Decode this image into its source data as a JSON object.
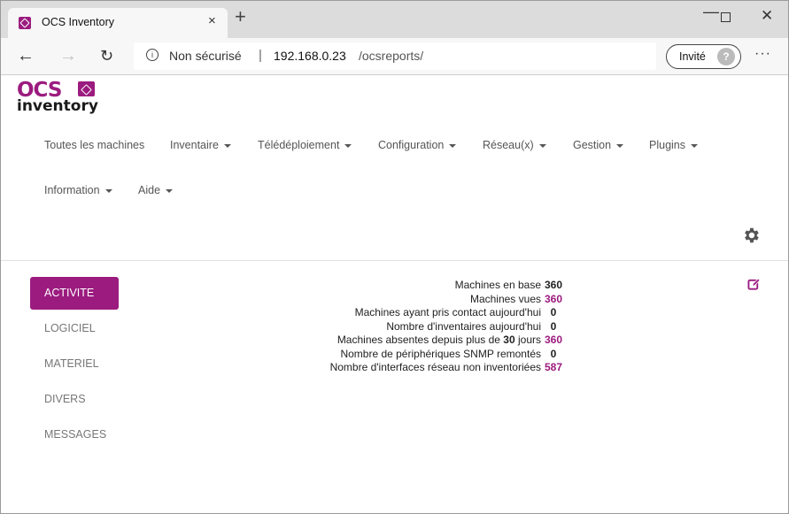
{
  "browser": {
    "tab_title": "OCS Inventory",
    "tab_close": "×",
    "new_tab": "+",
    "security_label": "Non sécurisé",
    "url_host": "192.168.0.23",
    "url_path": "/ocsreports/",
    "profile_label": "Invité",
    "more_menu": "···",
    "back": "←",
    "forward": "→",
    "reload": "↻",
    "minimize": "—",
    "close": "✕",
    "separator": "|"
  },
  "logo": {
    "top": "OCS",
    "bottom": "inventory"
  },
  "nav": {
    "row1": [
      {
        "label": "Toutes les machines",
        "dropdown": false
      },
      {
        "label": "Inventaire",
        "dropdown": true
      },
      {
        "label": "Télédéploiement",
        "dropdown": true
      },
      {
        "label": "Configuration",
        "dropdown": true
      },
      {
        "label": "Réseau(x)",
        "dropdown": true
      },
      {
        "label": "Gestion",
        "dropdown": true
      },
      {
        "label": "Plugins",
        "dropdown": true
      }
    ],
    "row2": [
      {
        "label": "Information",
        "dropdown": true
      },
      {
        "label": "Aide",
        "dropdown": true
      }
    ]
  },
  "sidebar": {
    "items": [
      {
        "label": "ACTIVITE",
        "active": true
      },
      {
        "label": "LOGICIEL",
        "active": false
      },
      {
        "label": "MATERIEL",
        "active": false
      },
      {
        "label": "DIVERS",
        "active": false
      },
      {
        "label": "MESSAGES",
        "active": false
      }
    ]
  },
  "stats": {
    "rows": [
      {
        "label": "Machines en base",
        "value": "360",
        "link": false
      },
      {
        "label": "Machines vues",
        "value": "360",
        "link": true
      },
      {
        "label": "Machines ayant pris contact aujourd'hui",
        "value": "0",
        "link": false
      },
      {
        "label": "Nombre d'inventaires aujourd'hui",
        "value": "0",
        "link": false
      },
      {
        "label_prefix": "Machines absentes depuis plus de",
        "label_bold": "30",
        "label_suffix": "jours",
        "value": "360",
        "link": true
      },
      {
        "label": "Nombre de périphériques SNMP remontés",
        "value": "0",
        "link": false
      },
      {
        "label": "Nombre d'interfaces réseau non inventoriées",
        "value": "587",
        "link": true
      }
    ]
  },
  "colors": {
    "brand": "#9b1b7f"
  },
  "icons": {
    "settings": "gear-icon",
    "edit": "edit-icon",
    "info": "info-icon"
  }
}
